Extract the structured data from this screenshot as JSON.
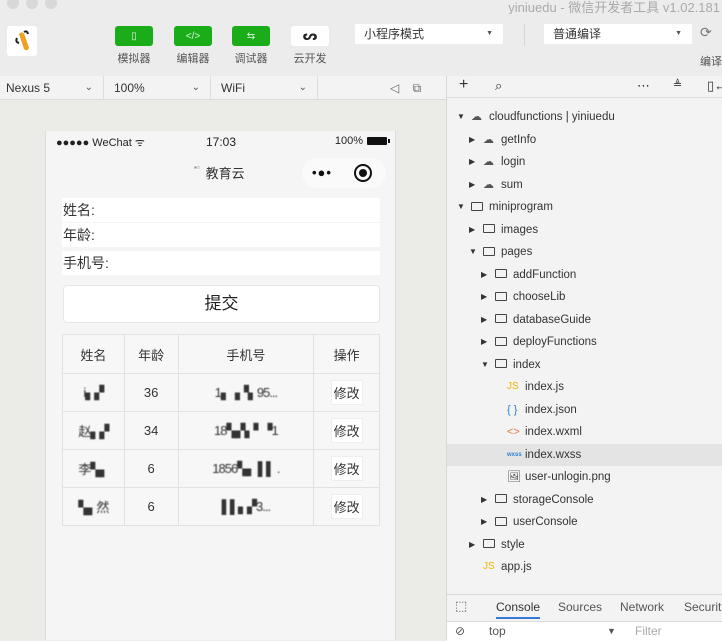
{
  "window": {
    "title": "yiniuedu - 微信开发者工具 v1.02.181"
  },
  "toolbar": {
    "simulator_label": "模拟器",
    "editor_label": "编辑器",
    "debugger_label": "调试器",
    "cloud_label": "云开发",
    "mode_select": "小程序模式",
    "compile_select": "普通编译",
    "compile_label": "编译",
    "accent_color": "#1aad19"
  },
  "simbar": {
    "device": "Nexus 5",
    "zoom": "100%",
    "network": "WiFi"
  },
  "phone": {
    "carrier": "●●●●● WeChat",
    "time": "17:03",
    "battery": "100%",
    "nav_title": "教育云",
    "fields": [
      {
        "label": "姓名:"
      },
      {
        "label": "年龄:"
      },
      {
        "label": "手机号:"
      }
    ],
    "submit_label": "提交",
    "table": {
      "headers": [
        "姓名",
        "年龄",
        "手机号",
        "操作"
      ],
      "rows": [
        {
          "name": "i▖▞",
          "age": "36",
          "phone": "1▖▗▝▖95...",
          "action": "修改"
        },
        {
          "name": "赵▖▞",
          "age": "34",
          "phone": "18▚▞▖▘▝1",
          "action": "修改"
        },
        {
          "name": "李▚▖",
          "age": "6",
          "phone": "1856▚▖ ▌▌ .",
          "action": "修改"
        },
        {
          "name": "▚▖然",
          "age": "6",
          "phone": "▌▌▖▞3...",
          "action": "修改"
        }
      ]
    }
  },
  "explorer": {
    "nodes": [
      {
        "name": "cloudfunctions | yiniuedu",
        "type": "cloud-root",
        "expanded": true,
        "depth": 0
      },
      {
        "name": "getInfo",
        "type": "cloud",
        "expanded": false,
        "depth": 1
      },
      {
        "name": "login",
        "type": "cloud",
        "expanded": false,
        "depth": 1
      },
      {
        "name": "sum",
        "type": "cloud",
        "expanded": false,
        "depth": 1
      },
      {
        "name": "miniprogram",
        "type": "folder-open",
        "expanded": true,
        "depth": 0
      },
      {
        "name": "images",
        "type": "folder",
        "expanded": false,
        "depth": 1
      },
      {
        "name": "pages",
        "type": "folder-open",
        "expanded": true,
        "depth": 1
      },
      {
        "name": "addFunction",
        "type": "folder",
        "expanded": false,
        "depth": 2
      },
      {
        "name": "chooseLib",
        "type": "folder",
        "expanded": false,
        "depth": 2
      },
      {
        "name": "databaseGuide",
        "type": "folder",
        "expanded": false,
        "depth": 2
      },
      {
        "name": "deployFunctions",
        "type": "folder",
        "expanded": false,
        "depth": 2
      },
      {
        "name": "index",
        "type": "folder-open",
        "expanded": true,
        "depth": 2
      },
      {
        "name": "index.js",
        "type": "js",
        "depth": 3
      },
      {
        "name": "index.json",
        "type": "json",
        "depth": 3
      },
      {
        "name": "index.wxml",
        "type": "wxml",
        "depth": 3
      },
      {
        "name": "index.wxss",
        "type": "wxss",
        "depth": 3,
        "selected": true
      },
      {
        "name": "user-unlogin.png",
        "type": "image",
        "depth": 3
      },
      {
        "name": "storageConsole",
        "type": "folder",
        "expanded": false,
        "depth": 2
      },
      {
        "name": "userConsole",
        "type": "folder",
        "expanded": false,
        "depth": 2
      },
      {
        "name": "style",
        "type": "folder",
        "expanded": false,
        "depth": 1
      },
      {
        "name": "app.js",
        "type": "js",
        "depth": 1
      }
    ]
  },
  "devtools": {
    "tabs": [
      "Console",
      "Sources",
      "Network",
      "Securit"
    ],
    "active_tab": "Console",
    "context": "top",
    "filter_placeholder": "Filter"
  }
}
